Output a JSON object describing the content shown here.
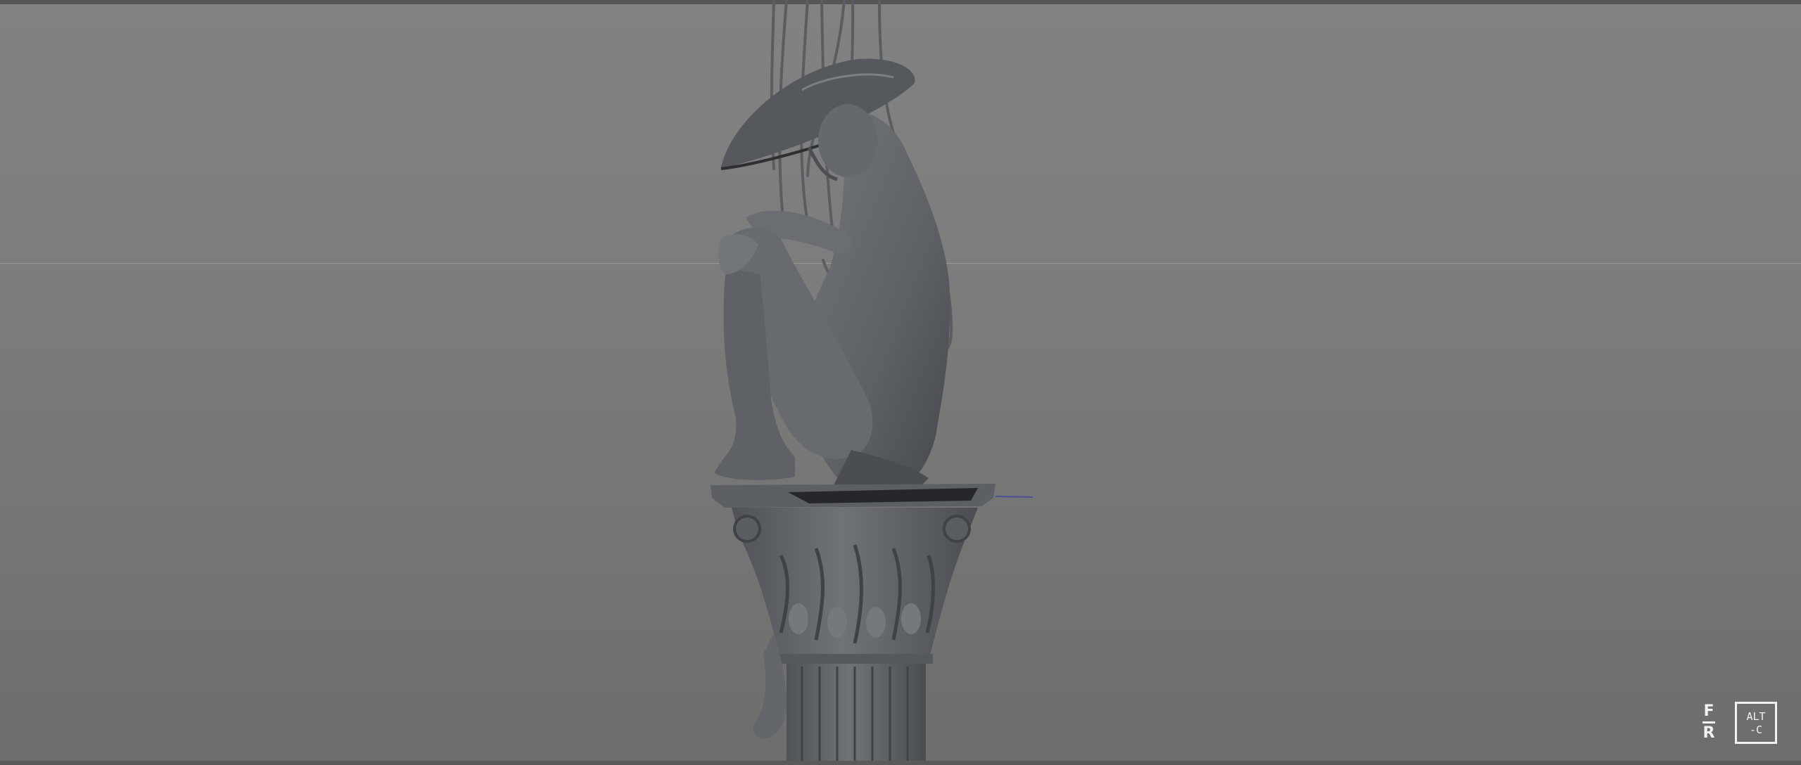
{
  "viewport": {
    "background_top": "#828282",
    "background_bottom": "#6d6d6d",
    "model_color": "#5f6266"
  },
  "watermark": {
    "fr_top": "F",
    "fr_bottom": "R",
    "altc_line1": "ALT",
    "altc_line2": "-C"
  }
}
